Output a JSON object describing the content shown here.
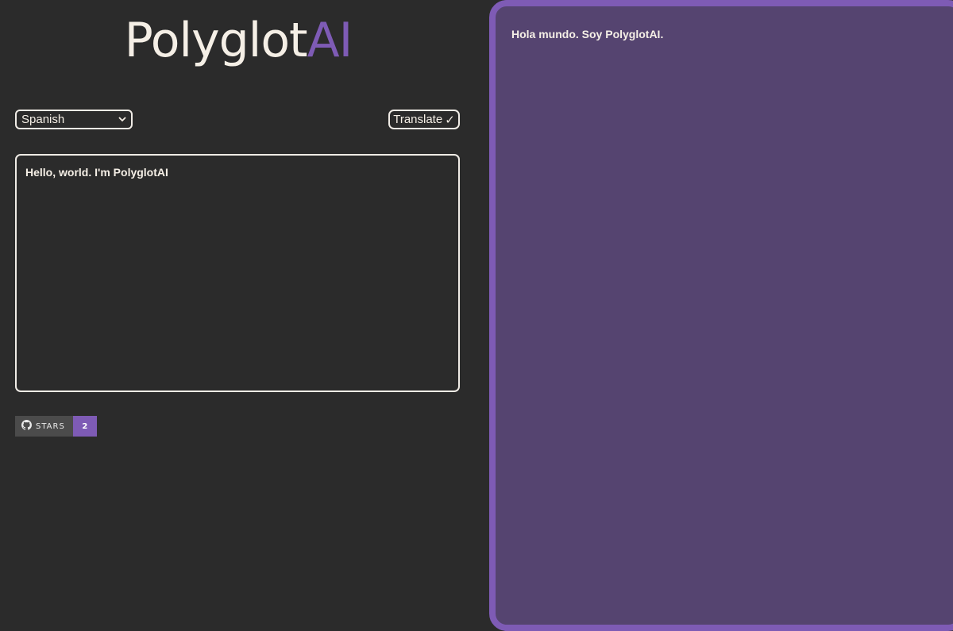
{
  "logo": {
    "main": "Polyglot",
    "accent": "AI"
  },
  "language_select": {
    "selected": "Spanish",
    "icon": "chevron-down-icon"
  },
  "translate_button": {
    "label": "Translate",
    "check": "✓"
  },
  "input": {
    "text": "Hello, world. I'm PolyglotAI"
  },
  "github_badge": {
    "label": "STARS",
    "count": "2",
    "icon": "github-icon"
  },
  "output": {
    "text": "Hola mundo. Soy PolyglotAI."
  },
  "colors": {
    "background": "#2b2b2b",
    "accent": "#7e5bb5",
    "output_background": "#554470",
    "text": "#f5efe6"
  }
}
